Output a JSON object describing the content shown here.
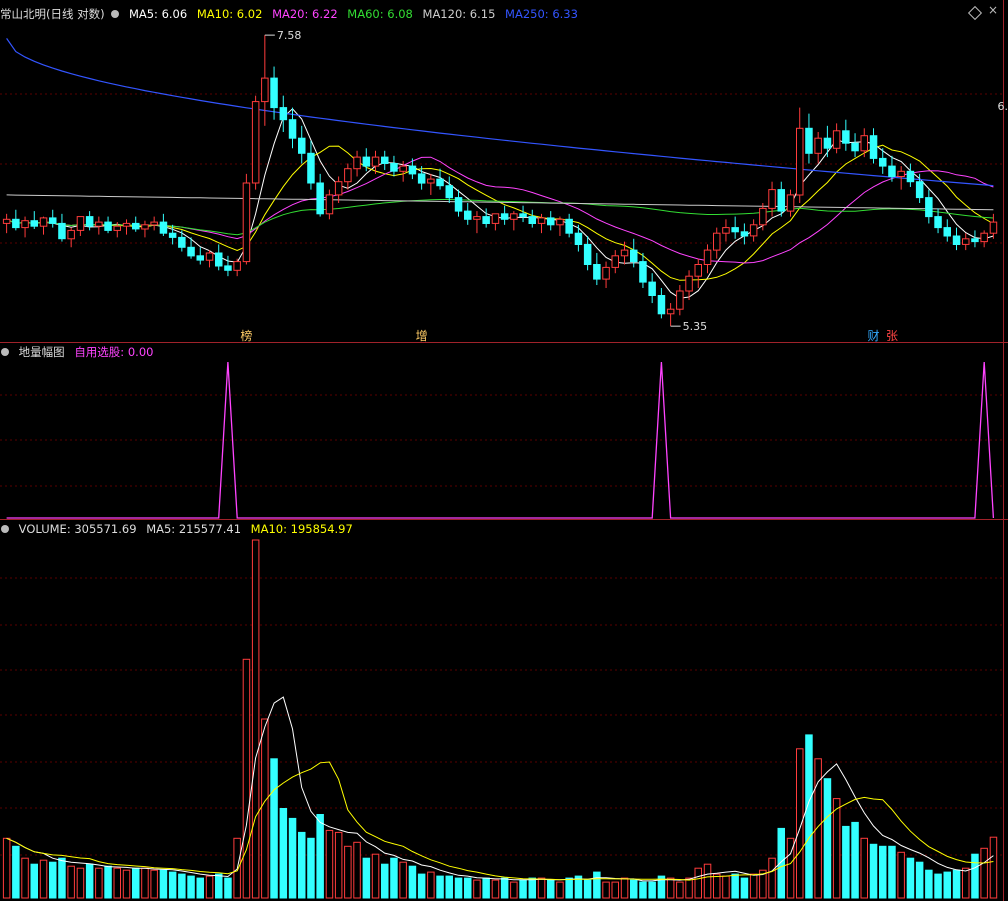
{
  "header": {
    "stock_name": "常山北明(日线 对数)",
    "ma_items": [
      {
        "label": "MA5: 6.06",
        "color": "#ffffff"
      },
      {
        "label": "MA10: 6.02",
        "color": "#ffff00"
      },
      {
        "label": "MA20: 6.22",
        "color": "#ff44ff"
      },
      {
        "label": "MA60: 6.08",
        "color": "#33dd33"
      },
      {
        "label": "MA120: 6.15",
        "color": "#cccccc"
      },
      {
        "label": "MA250: 6.33",
        "color": "#3355ff"
      }
    ],
    "right_price_label": "6."
  },
  "indicator_panel": {
    "title": "地量幅图",
    "value_label": "自用选股: 0.00",
    "value_color": "#ff44ff"
  },
  "volume_panel": {
    "title": "VOLUME: 305571.69",
    "ma5_label": "MA5: 215577.41",
    "ma10_label": "MA10: 195854.97"
  },
  "price_annotations": {
    "high_label": "7.58",
    "low_label": "5.35",
    "markers": [
      {
        "text": "榜",
        "color": "#ffcc66"
      },
      {
        "text": "增",
        "color": "#ffcc66"
      },
      {
        "text": "财",
        "color": "#33aaff"
      },
      {
        "text": "张",
        "color": "#ff4444"
      }
    ]
  },
  "colors": {
    "up": "#ff3c3c",
    "down": "#33ffff",
    "grid": "#5a0000",
    "separator": "#a0222a",
    "ma5": "#ffffff",
    "ma10": "#ffff00",
    "ma20": "#ff44ff",
    "ma60": "#33dd33",
    "ma120": "#cccccc",
    "ma250": "#3355ff",
    "indicator": "#ff44ff"
  },
  "chart_data": [
    {
      "type": "candlestick",
      "title": "常山北明(日线 对数)",
      "y_scale": "log",
      "ylim": [
        5.3,
        7.7
      ],
      "high_point": 7.58,
      "low_point": 5.35,
      "ma_last": {
        "MA5": 6.06,
        "MA10": 6.02,
        "MA20": 6.22,
        "MA60": 6.08,
        "MA120": 6.15,
        "MA250": 6.33
      },
      "ohlc": [
        [
          6.05,
          6.12,
          5.98,
          6.08
        ],
        [
          6.08,
          6.15,
          6.0,
          6.02
        ],
        [
          6.02,
          6.1,
          5.95,
          6.07
        ],
        [
          6.07,
          6.14,
          6.01,
          6.03
        ],
        [
          6.03,
          6.1,
          5.97,
          6.09
        ],
        [
          6.09,
          6.15,
          6.02,
          6.05
        ],
        [
          6.05,
          6.12,
          5.92,
          5.94
        ],
        [
          5.94,
          6.02,
          5.88,
          6.0
        ],
        [
          6.0,
          6.08,
          5.96,
          6.1
        ],
        [
          6.1,
          6.14,
          6.0,
          6.03
        ],
        [
          6.03,
          6.1,
          5.97,
          6.06
        ],
        [
          6.06,
          6.1,
          5.98,
          6.0
        ],
        [
          6.0,
          6.06,
          5.95,
          6.03
        ],
        [
          6.03,
          6.08,
          5.97,
          6.05
        ],
        [
          6.05,
          6.1,
          5.99,
          6.01
        ],
        [
          6.01,
          6.07,
          5.95,
          6.04
        ],
        [
          6.04,
          6.1,
          6.0,
          6.06
        ],
        [
          6.06,
          6.12,
          5.96,
          5.98
        ],
        [
          5.98,
          6.04,
          5.9,
          5.95
        ],
        [
          5.95,
          6.0,
          5.85,
          5.88
        ],
        [
          5.88,
          5.95,
          5.8,
          5.82
        ],
        [
          5.82,
          5.88,
          5.76,
          5.79
        ],
        [
          5.79,
          5.86,
          5.74,
          5.84
        ],
        [
          5.84,
          5.9,
          5.72,
          5.75
        ],
        [
          5.75,
          5.82,
          5.68,
          5.72
        ],
        [
          5.72,
          5.8,
          5.68,
          5.78
        ],
        [
          5.78,
          6.42,
          5.76,
          6.35
        ],
        [
          6.35,
          7.05,
          6.3,
          7.0
        ],
        [
          7.0,
          7.58,
          6.8,
          7.2
        ],
        [
          7.2,
          7.3,
          6.85,
          6.95
        ],
        [
          6.95,
          7.05,
          6.75,
          6.85
        ],
        [
          6.85,
          6.95,
          6.62,
          6.7
        ],
        [
          6.7,
          6.8,
          6.5,
          6.58
        ],
        [
          6.58,
          6.68,
          6.3,
          6.35
        ],
        [
          6.35,
          6.42,
          6.1,
          6.12
        ],
        [
          6.12,
          6.3,
          6.08,
          6.26
        ],
        [
          6.26,
          6.4,
          6.2,
          6.36
        ],
        [
          6.36,
          6.5,
          6.3,
          6.46
        ],
        [
          6.46,
          6.6,
          6.4,
          6.55
        ],
        [
          6.55,
          6.62,
          6.44,
          6.48
        ],
        [
          6.48,
          6.6,
          6.42,
          6.55
        ],
        [
          6.55,
          6.6,
          6.45,
          6.5
        ],
        [
          6.5,
          6.56,
          6.4,
          6.44
        ],
        [
          6.44,
          6.52,
          6.36,
          6.48
        ],
        [
          6.48,
          6.54,
          6.38,
          6.42
        ],
        [
          6.42,
          6.48,
          6.3,
          6.35
        ],
        [
          6.35,
          6.42,
          6.26,
          6.38
        ],
        [
          6.38,
          6.46,
          6.3,
          6.33
        ],
        [
          6.33,
          6.4,
          6.2,
          6.24
        ],
        [
          6.24,
          6.3,
          6.1,
          6.14
        ],
        [
          6.14,
          6.2,
          6.04,
          6.08
        ],
        [
          6.08,
          6.14,
          5.98,
          6.1
        ],
        [
          6.1,
          6.16,
          6.02,
          6.05
        ],
        [
          6.05,
          6.12,
          6.0,
          6.12
        ],
        [
          6.12,
          6.18,
          6.04,
          6.08
        ],
        [
          6.08,
          6.14,
          6.0,
          6.12
        ],
        [
          6.12,
          6.18,
          6.06,
          6.1
        ],
        [
          6.1,
          6.15,
          6.02,
          6.05
        ],
        [
          6.05,
          6.12,
          5.98,
          6.09
        ],
        [
          6.09,
          6.14,
          6.0,
          6.04
        ],
        [
          6.04,
          6.1,
          5.96,
          6.08
        ],
        [
          6.08,
          6.12,
          5.95,
          5.98
        ],
        [
          5.98,
          6.04,
          5.85,
          5.9
        ],
        [
          5.9,
          5.96,
          5.72,
          5.76
        ],
        [
          5.76,
          5.84,
          5.62,
          5.66
        ],
        [
          5.66,
          5.78,
          5.6,
          5.74
        ],
        [
          5.74,
          5.86,
          5.7,
          5.82
        ],
        [
          5.82,
          5.92,
          5.76,
          5.86
        ],
        [
          5.86,
          5.94,
          5.74,
          5.78
        ],
        [
          5.78,
          5.84,
          5.6,
          5.64
        ],
        [
          5.64,
          5.7,
          5.5,
          5.55
        ],
        [
          5.55,
          5.6,
          5.4,
          5.43
        ],
        [
          5.43,
          5.5,
          5.35,
          5.46
        ],
        [
          5.46,
          5.62,
          5.42,
          5.58
        ],
        [
          5.58,
          5.72,
          5.52,
          5.68
        ],
        [
          5.68,
          5.8,
          5.6,
          5.76
        ],
        [
          5.76,
          5.9,
          5.7,
          5.86
        ],
        [
          5.86,
          6.02,
          5.8,
          5.98
        ],
        [
          5.98,
          6.08,
          5.92,
          6.02
        ],
        [
          6.02,
          6.1,
          5.94,
          5.99
        ],
        [
          5.99,
          6.05,
          5.9,
          5.96
        ],
        [
          5.96,
          6.08,
          5.92,
          6.04
        ],
        [
          6.04,
          6.2,
          6.0,
          6.16
        ],
        [
          6.16,
          6.36,
          6.1,
          6.3
        ],
        [
          6.3,
          6.36,
          6.1,
          6.14
        ],
        [
          6.14,
          6.3,
          6.1,
          6.26
        ],
        [
          6.26,
          6.95,
          6.2,
          6.78
        ],
        [
          6.78,
          6.9,
          6.5,
          6.58
        ],
        [
          6.58,
          6.75,
          6.5,
          6.7
        ],
        [
          6.7,
          6.8,
          6.55,
          6.62
        ],
        [
          6.62,
          6.82,
          6.58,
          6.76
        ],
        [
          6.76,
          6.85,
          6.6,
          6.66
        ],
        [
          6.66,
          6.74,
          6.55,
          6.6
        ],
        [
          6.6,
          6.78,
          6.55,
          6.72
        ],
        [
          6.72,
          6.78,
          6.5,
          6.54
        ],
        [
          6.54,
          6.62,
          6.42,
          6.48
        ],
        [
          6.48,
          6.56,
          6.36,
          6.4
        ],
        [
          6.4,
          6.48,
          6.3,
          6.44
        ],
        [
          6.44,
          6.5,
          6.32,
          6.36
        ],
        [
          6.36,
          6.42,
          6.2,
          6.24
        ],
        [
          6.24,
          6.3,
          6.05,
          6.1
        ],
        [
          6.1,
          6.16,
          5.98,
          6.02
        ],
        [
          6.02,
          6.08,
          5.92,
          5.96
        ],
        [
          5.96,
          6.02,
          5.86,
          5.9
        ],
        [
          5.9,
          5.98,
          5.86,
          5.94
        ],
        [
          5.94,
          6.0,
          5.88,
          5.92
        ],
        [
          5.92,
          6.0,
          5.88,
          5.98
        ],
        [
          5.98,
          6.12,
          5.94,
          6.06
        ]
      ]
    },
    {
      "type": "line",
      "title": "地量幅图",
      "series": [
        {
          "name": "自用选股",
          "values": [
            0,
            0,
            0,
            0,
            0,
            0,
            0,
            0,
            0,
            0,
            0,
            0,
            0,
            0,
            0,
            0,
            0,
            0,
            0,
            0,
            0,
            0,
            0,
            0,
            1,
            0,
            0,
            0,
            0,
            0,
            0,
            0,
            0,
            0,
            0,
            0,
            0,
            0,
            0,
            0,
            0,
            0,
            0,
            0,
            0,
            0,
            0,
            0,
            0,
            0,
            0,
            0,
            0,
            0,
            0,
            0,
            0,
            0,
            0,
            0,
            0,
            0,
            0,
            0,
            0,
            0,
            0,
            0,
            0,
            0,
            0,
            1,
            0,
            0,
            0,
            0,
            0,
            0,
            0,
            0,
            0,
            0,
            0,
            0,
            0,
            0,
            0,
            0,
            0,
            0,
            0,
            0,
            0,
            0,
            0,
            0,
            0,
            0,
            0,
            0,
            0,
            0,
            0,
            0,
            0,
            0,
            1,
            0
          ]
        }
      ],
      "ylim": [
        0,
        1
      ]
    },
    {
      "type": "bar",
      "title": "VOLUME",
      "last_values": {
        "VOLUME": 305571.69,
        "MA5": 215577.41,
        "MA10": 195854.97
      },
      "ylim": [
        0,
        1800000
      ],
      "values": [
        300000,
        260000,
        200000,
        170000,
        190000,
        180000,
        200000,
        160000,
        150000,
        170000,
        150000,
        160000,
        150000,
        140000,
        150000,
        150000,
        140000,
        140000,
        130000,
        120000,
        110000,
        100000,
        110000,
        120000,
        100000,
        300000,
        1200000,
        1800000,
        900000,
        700000,
        450000,
        400000,
        330000,
        300000,
        420000,
        340000,
        330000,
        260000,
        280000,
        200000,
        220000,
        170000,
        200000,
        180000,
        160000,
        120000,
        130000,
        110000,
        110000,
        100000,
        100000,
        90000,
        100000,
        90000,
        100000,
        80000,
        90000,
        100000,
        100000,
        90000,
        80000,
        100000,
        110000,
        90000,
        130000,
        80000,
        80000,
        100000,
        90000,
        80000,
        80000,
        110000,
        100000,
        80000,
        100000,
        150000,
        170000,
        120000,
        110000,
        120000,
        100000,
        120000,
        140000,
        200000,
        350000,
        300000,
        750000,
        820000,
        700000,
        600000,
        500000,
        360000,
        380000,
        300000,
        270000,
        260000,
        260000,
        230000,
        200000,
        180000,
        140000,
        120000,
        130000,
        140000,
        150000,
        220000,
        250000,
        305571.69
      ]
    }
  ]
}
